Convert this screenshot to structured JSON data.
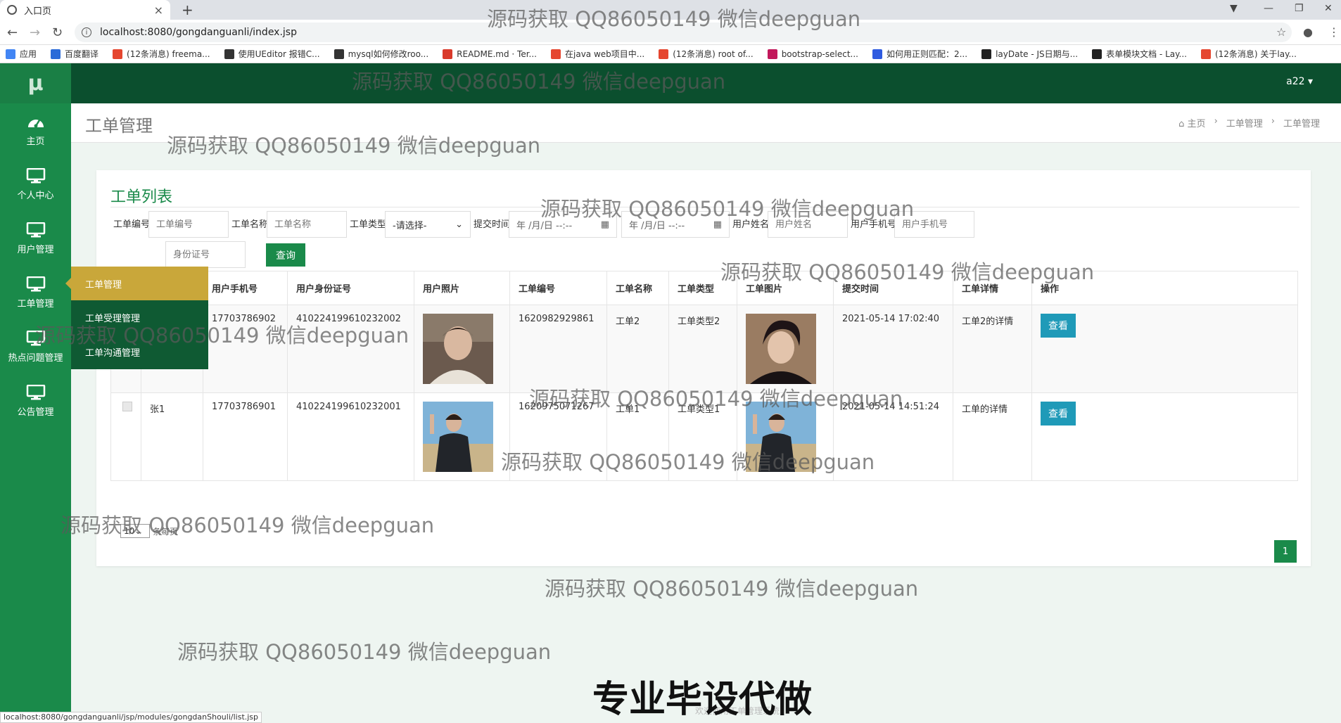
{
  "browser": {
    "tab_title": "入口页",
    "url": "localhost:8080/gongdanguanli/index.jsp",
    "bookmarks": [
      {
        "label": "应用",
        "color": "#4285f4"
      },
      {
        "label": "百度翻译",
        "color": "#2b6bd8"
      },
      {
        "label": "(12条消息) freema...",
        "color": "#e5462f"
      },
      {
        "label": "使用UEditor 报错C...",
        "color": "#333333"
      },
      {
        "label": "mysql如何修改roo...",
        "color": "#333333"
      },
      {
        "label": "README.md · Ter...",
        "color": "#d93a2b"
      },
      {
        "label": "在java web项目中...",
        "color": "#e5462f"
      },
      {
        "label": "(12条消息) root of...",
        "color": "#e5462f"
      },
      {
        "label": "bootstrap-select...",
        "color": "#c2185b"
      },
      {
        "label": "如何用正则匹配：2...",
        "color": "#2f5be0"
      },
      {
        "label": "layDate - JS日期与...",
        "color": "#222222"
      },
      {
        "label": "表单模块文档 - Lay...",
        "color": "#222222"
      },
      {
        "label": "(12条消息) 关于lay...",
        "color": "#e5462f"
      }
    ],
    "status_url": "localhost:8080/gongdanguanli/jsp/modules/gongdanShouli/list.jsp"
  },
  "header": {
    "logo": "μ",
    "user": "a22 ▾"
  },
  "sidebar": {
    "items": [
      {
        "label": "主页",
        "icon": "dashboard-icon"
      },
      {
        "label": "个人中心",
        "icon": "monitor-icon"
      },
      {
        "label": "用户管理",
        "icon": "monitor-icon"
      },
      {
        "label": "工单管理",
        "icon": "monitor-icon"
      },
      {
        "label": "热点问题管理",
        "icon": "monitor-icon"
      },
      {
        "label": "公告管理",
        "icon": "monitor-icon"
      }
    ],
    "flyout": {
      "title": "工单管理",
      "items": [
        "工单受理管理",
        "工单沟通管理"
      ]
    }
  },
  "page": {
    "title": "工单管理",
    "breadcrumb": [
      "主页",
      "工单管理",
      "工单管理"
    ],
    "card_title": "工单列表"
  },
  "filters": {
    "order_no_label": "工单编号",
    "order_no_placeholder": "工单编号",
    "order_name_label": "工单名称",
    "order_name_placeholder": "工单名称",
    "order_type_label": "工单类型",
    "order_type_value": "-请选择-",
    "submit_time_label": "提交时间",
    "date_placeholder": "年 /月/日 --:--",
    "user_name_label": "用户姓名",
    "user_name_placeholder": "用户姓名",
    "user_phone_label": "用户手机号",
    "user_phone_placeholder": "用户手机号",
    "id_card_placeholder": "身份证号",
    "query_label": "查询"
  },
  "table": {
    "columns": [
      "",
      "用户姓名",
      "用户手机号",
      "用户身份证号",
      "用户照片",
      "工单编号",
      "工单名称",
      "工单类型",
      "工单图片",
      "提交时间",
      "工单详情",
      "操作"
    ],
    "rows": [
      {
        "name": "",
        "phone": "17703786902",
        "id_card": "410224199610232002",
        "order_no": "1620982929861",
        "order_name": "工单2",
        "order_type": "工单类型2",
        "submit_time": "2021-05-14 17:02:40",
        "detail": "工单2的详情",
        "action": "查看"
      },
      {
        "name": "张1",
        "phone": "17703786901",
        "id_card": "410224199610232001",
        "order_no": "1620975071267",
        "order_name": "工单1",
        "order_type": "工单类型1",
        "submit_time": "2021-05-14 14:51:24",
        "detail": "工单的详情",
        "action": "查看"
      }
    ]
  },
  "pager": {
    "page_size": "10",
    "per_page_text": "条每页",
    "current_page": "1"
  },
  "watermark": "源码获取 QQ86050149 微信deepguan",
  "banner": "专业毕设代做",
  "footer_faint": "欢迎使用工单管理系统"
}
